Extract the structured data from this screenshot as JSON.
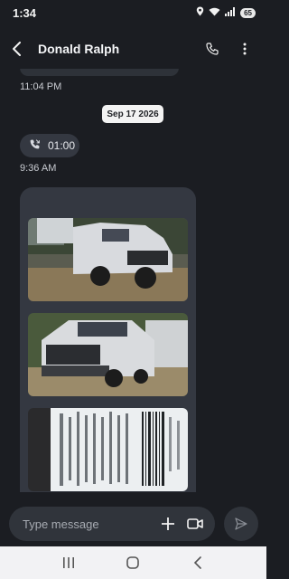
{
  "status_bar": {
    "time": "1:34",
    "battery": "65"
  },
  "header": {
    "contact_name": "Donald Ralph"
  },
  "messages": {
    "prev_timestamp": "11:04 PM",
    "date_chip": "Sep 17 2026",
    "call": {
      "duration": "01:00",
      "timestamp": "9:36 AM"
    },
    "photos": [
      {
        "subject": "white pickup truck with utility bed, side view"
      },
      {
        "subject": "white pickup truck, front view"
      },
      {
        "subject": "vehicle label sticker"
      }
    ]
  },
  "composer": {
    "placeholder": "Type message"
  },
  "icons": {
    "back": "back-arrow-icon",
    "call": "phone-icon",
    "menu": "more-vertical-icon",
    "add": "plus-icon",
    "video": "video-camera-icon",
    "send": "send-icon"
  },
  "colors": {
    "background": "#1b1d22",
    "bubble": "#343841",
    "input": "#30343b",
    "nav": "#f2f2f4"
  }
}
